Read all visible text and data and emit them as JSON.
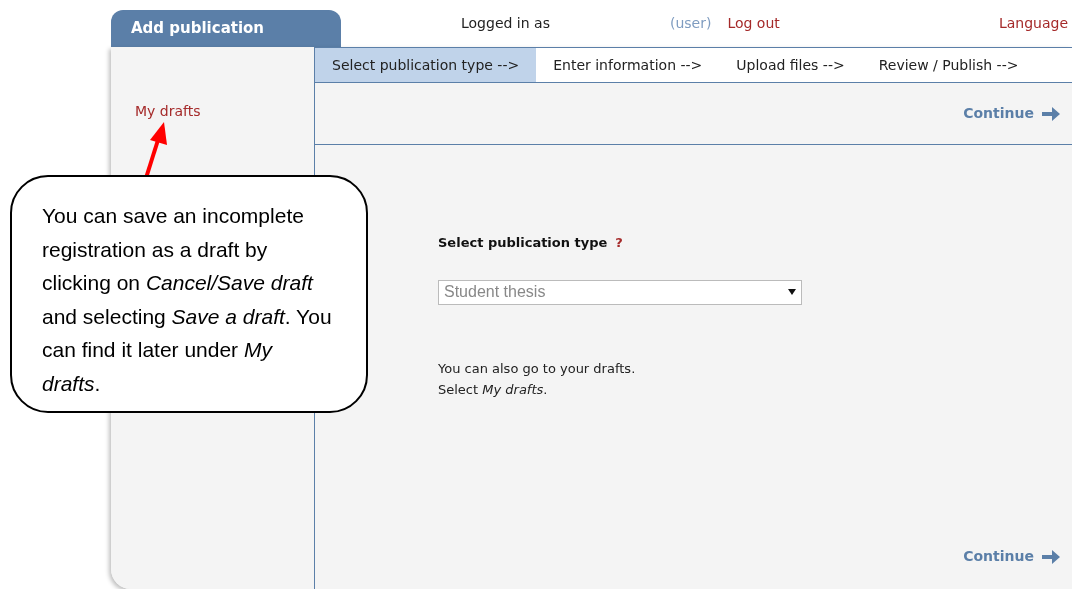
{
  "app_tab": {
    "label": "Add publication",
    "selected": true
  },
  "header": {
    "logged_in": "Logged in as",
    "user": "(user)",
    "logout": "Log out",
    "language": "Language"
  },
  "sidebar": {
    "items": [
      {
        "label": "My drafts",
        "selected": false
      }
    ]
  },
  "steps": [
    {
      "label": "Select publication type -->",
      "selected": true
    },
    {
      "label": "Enter information -->",
      "selected": false
    },
    {
      "label": "Upload files -->",
      "selected": false
    },
    {
      "label": "Review / Publish -->",
      "selected": false
    }
  ],
  "continue_top": "Continue",
  "form": {
    "label": "Select publication type",
    "help": "?",
    "select_value": "Student thesis"
  },
  "hint": [
    "You can also go to your drafts.",
    "Select *My drafts*."
  ],
  "continue_bottom": "Continue",
  "callout": {
    "text": "You can save an incomplete registration as a draft by clicking on *Cancel/Save draft* and selecting *Save a draft*. You can find it later under *My drafts*."
  }
}
